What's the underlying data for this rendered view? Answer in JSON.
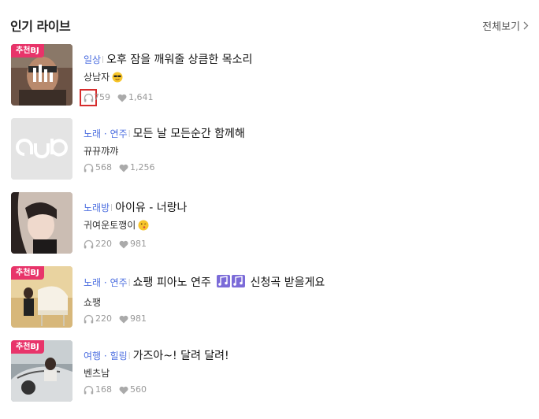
{
  "header": {
    "title": "인기 라이브",
    "view_all": "전체보기"
  },
  "colors": {
    "badge": "#e8346a",
    "category": "#4d6fe0",
    "highlight_box": "#d62d2d"
  },
  "items": [
    {
      "badge": "추천BJ",
      "category": "일상",
      "title": "오후 잠을 깨워줄 상큼한 목소리",
      "streamer": "상남자",
      "streamer_emoji": "sunglasses-face",
      "listeners": "759",
      "likes": "1,641"
    },
    {
      "badge": "",
      "category": "노래 · 연주",
      "title": "모든 날 모든순간 함께해",
      "streamer": "뀨뀨꺄꺄",
      "listeners": "568",
      "likes": "1,256"
    },
    {
      "badge": "",
      "category": "노래방",
      "title": "아이유 - 너랑나",
      "streamer": "귀여운토깽이",
      "streamer_emoji": "kiss-face",
      "listeners": "220",
      "likes": "981"
    },
    {
      "badge": "추천BJ",
      "category": "노래 · 연주",
      "title": "쇼팽 피아노 연주",
      "title_suffix": "신청곡 받을게요",
      "title_emoji": "music-notes",
      "streamer": "쇼팽",
      "listeners": "220",
      "likes": "981"
    },
    {
      "badge": "추천BJ",
      "category": "여행 · 힐링",
      "title": "가즈아~! 달려 달려!",
      "streamer": "벤츠남",
      "listeners": "168",
      "likes": "560"
    }
  ]
}
